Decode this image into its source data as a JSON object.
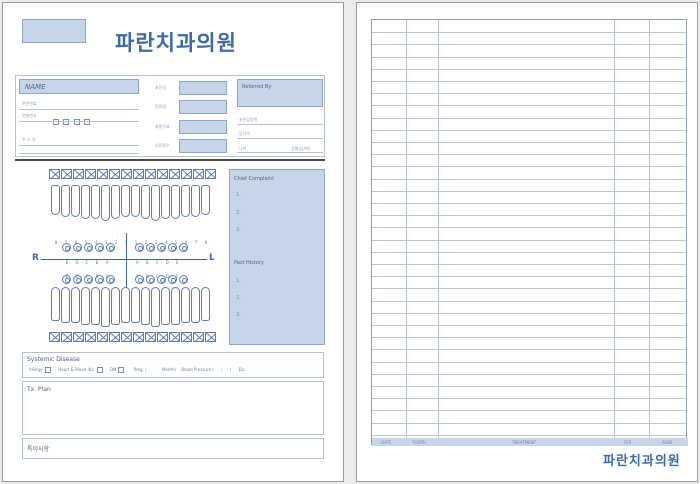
{
  "left_page": {
    "clinic_name": "파란치과의원",
    "patient": {
      "name_label": "NAME",
      "reg_label": "주민번호",
      "phone_label": "전화번호",
      "address_label": "주 소 지",
      "phone_dash": "-"
    },
    "center_fields": [
      "초진일",
      "진료일",
      "최종진료",
      "진료횟수"
    ],
    "referred_by_label": "Referred By",
    "right_fields": {
      "doctor_label": "초진담당의",
      "doctor2_label": "담당의",
      "age_label": "나이",
      "sex_label": "성별(남/여)"
    },
    "chart": {
      "right_label": "R",
      "left_label": "L",
      "upper_perm_numbers": [
        "8",
        "7",
        "6",
        "5",
        "4",
        "3",
        "2",
        "1",
        "1",
        "2",
        "3",
        "4",
        "5",
        "6",
        "7",
        "8"
      ],
      "upper_prim_letters": [
        "E",
        "D",
        "C",
        "B",
        "A",
        "A",
        "B",
        "C",
        "D",
        "E"
      ],
      "lower_prim_letters": [
        "E",
        "D",
        "C",
        "B",
        "A",
        "A",
        "B",
        "C",
        "D",
        "E"
      ],
      "lower_perm_numbers": [
        "8",
        "7",
        "6",
        "5",
        "4",
        "3",
        "2",
        "1",
        "1",
        "2",
        "3",
        "4",
        "5",
        "6",
        "7",
        "8"
      ]
    },
    "complaint": {
      "chief_title": "Chief Complaint",
      "chief_items": [
        "1.",
        "2.",
        "3."
      ],
      "past_title": "Past History",
      "past_items": [
        "1.",
        "2.",
        "3."
      ]
    },
    "systemic": {
      "title": "Systemic Disease",
      "items": [
        "Allergy",
        "Heart & Blood dis.",
        "DM",
        "Preg. (",
        "Month)",
        "Blood Pressure (",
        "/",
        ")",
        "Etc."
      ]
    },
    "tx_plan_title": "Tx. Plan",
    "notes_title": "특이사항"
  },
  "right_page": {
    "clinic_name": "파란치과의원",
    "footer_labels": [
      "DATE",
      "TOOTH",
      "TREATMENT",
      "FEE",
      "SIGN"
    ]
  }
}
